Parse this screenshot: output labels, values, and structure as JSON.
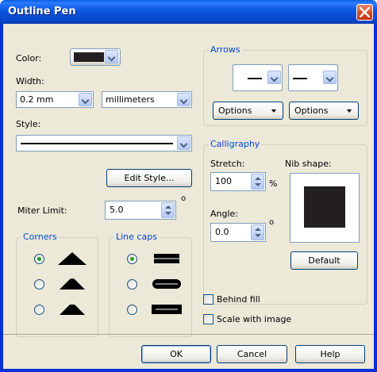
{
  "window": {
    "title": "Outline Pen"
  },
  "color": {
    "label": "Color:",
    "swatch": "#231f20"
  },
  "width": {
    "label": "Width:",
    "value": "0.2 mm",
    "units": "millimeters"
  },
  "style": {
    "label": "Style:"
  },
  "edit_style": {
    "label": "Edit Style..."
  },
  "miter": {
    "label": "Miter Limit:",
    "value": "5.0",
    "unit": "o"
  },
  "corners": {
    "title": "Corners",
    "selected": 0
  },
  "linecaps": {
    "title": "Line caps",
    "selected": 0
  },
  "arrows": {
    "title": "Arrows",
    "options_left": "Options",
    "options_right": "Options"
  },
  "calligraphy": {
    "title": "Calligraphy",
    "stretch_label": "Stretch:",
    "stretch_value": "100",
    "stretch_unit": "%",
    "angle_label": "Angle:",
    "angle_value": "0.0",
    "angle_unit": "o",
    "nib_label": "Nib shape:",
    "nib_color": "#231f20",
    "default_label": "Default"
  },
  "behind_fill": {
    "label": "Behind fill",
    "checked": false
  },
  "scale_image": {
    "label": "Scale with image",
    "checked": false
  },
  "buttons": {
    "ok": "OK",
    "cancel": "Cancel",
    "help": "Help"
  }
}
